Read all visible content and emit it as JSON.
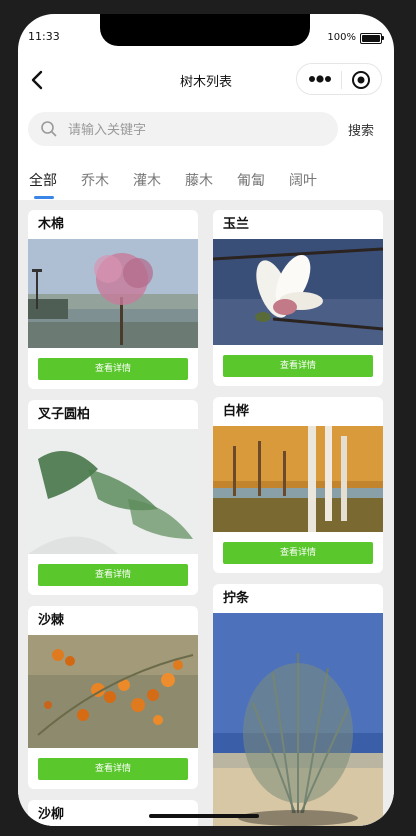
{
  "status": {
    "time": "11:33",
    "battery_text": "100%"
  },
  "navbar": {
    "title": "树木列表"
  },
  "search": {
    "placeholder": "请输入关键字",
    "button_label": "搜索"
  },
  "tabs": [
    {
      "label": "全部"
    },
    {
      "label": "乔木"
    },
    {
      "label": "灌木"
    },
    {
      "label": "藤木"
    },
    {
      "label": "匍匐"
    },
    {
      "label": "阔叶"
    }
  ],
  "cards": {
    "left": [
      {
        "title": "木棉",
        "button": "查看详情"
      },
      {
        "title": "叉子圆柏",
        "button": "查看详情"
      },
      {
        "title": "沙棘",
        "button": "查看详情"
      },
      {
        "title": "沙柳"
      }
    ],
    "right": [
      {
        "title": "玉兰",
        "button": "查看详情"
      },
      {
        "title": "白桦",
        "button": "查看详情"
      },
      {
        "title": "拧条"
      }
    ]
  },
  "colors": {
    "accent_button": "#5ac72d",
    "tab_underline": "#3a86e8",
    "page_bg": "#ededed"
  },
  "icons": [
    "back-arrow-icon",
    "more-dots-icon",
    "target-circle-icon",
    "search-icon",
    "battery-icon"
  ]
}
